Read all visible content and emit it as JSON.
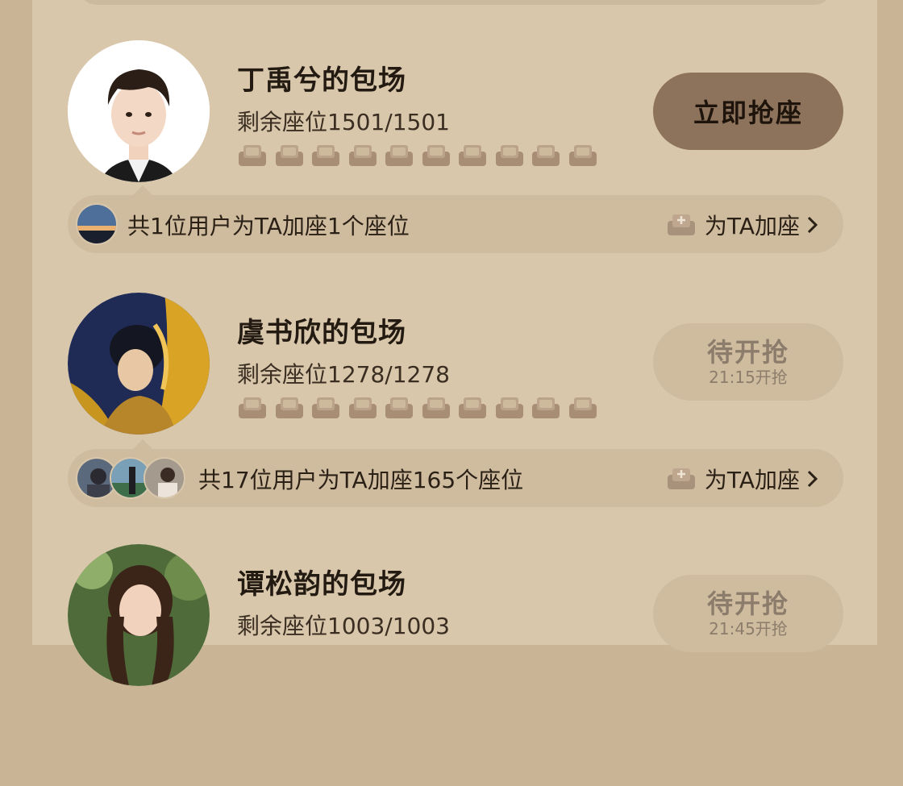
{
  "colors": {
    "accent_button": "#8e735c",
    "waiting_button": "#cfbc9f",
    "seat_icon": "#a98e76"
  },
  "cards": [
    {
      "title": "丁禹兮的包场",
      "seats": "剩余座位1501/1501",
      "button_label": "立即抢座",
      "button_sub": "",
      "button_state": "active",
      "supporters_text": "共1位用户为TA加座1个座位",
      "add_seat_label": "为TA加座"
    },
    {
      "title": "虞书欣的包场",
      "seats": "剩余座位1278/1278",
      "button_label": "待开抢",
      "button_sub": "21:15开抢",
      "button_state": "waiting",
      "supporters_text": "共17位用户为TA加座165个座位",
      "add_seat_label": "为TA加座"
    },
    {
      "title": "谭松韵的包场",
      "seats": "剩余座位1003/1003",
      "button_label": "待开抢",
      "button_sub": "21:45开抢",
      "button_state": "waiting"
    }
  ],
  "icons": {
    "seat": "armchair-icon",
    "add_seat": "armchair-plus-icon",
    "chevron": "chevron-right-icon"
  }
}
